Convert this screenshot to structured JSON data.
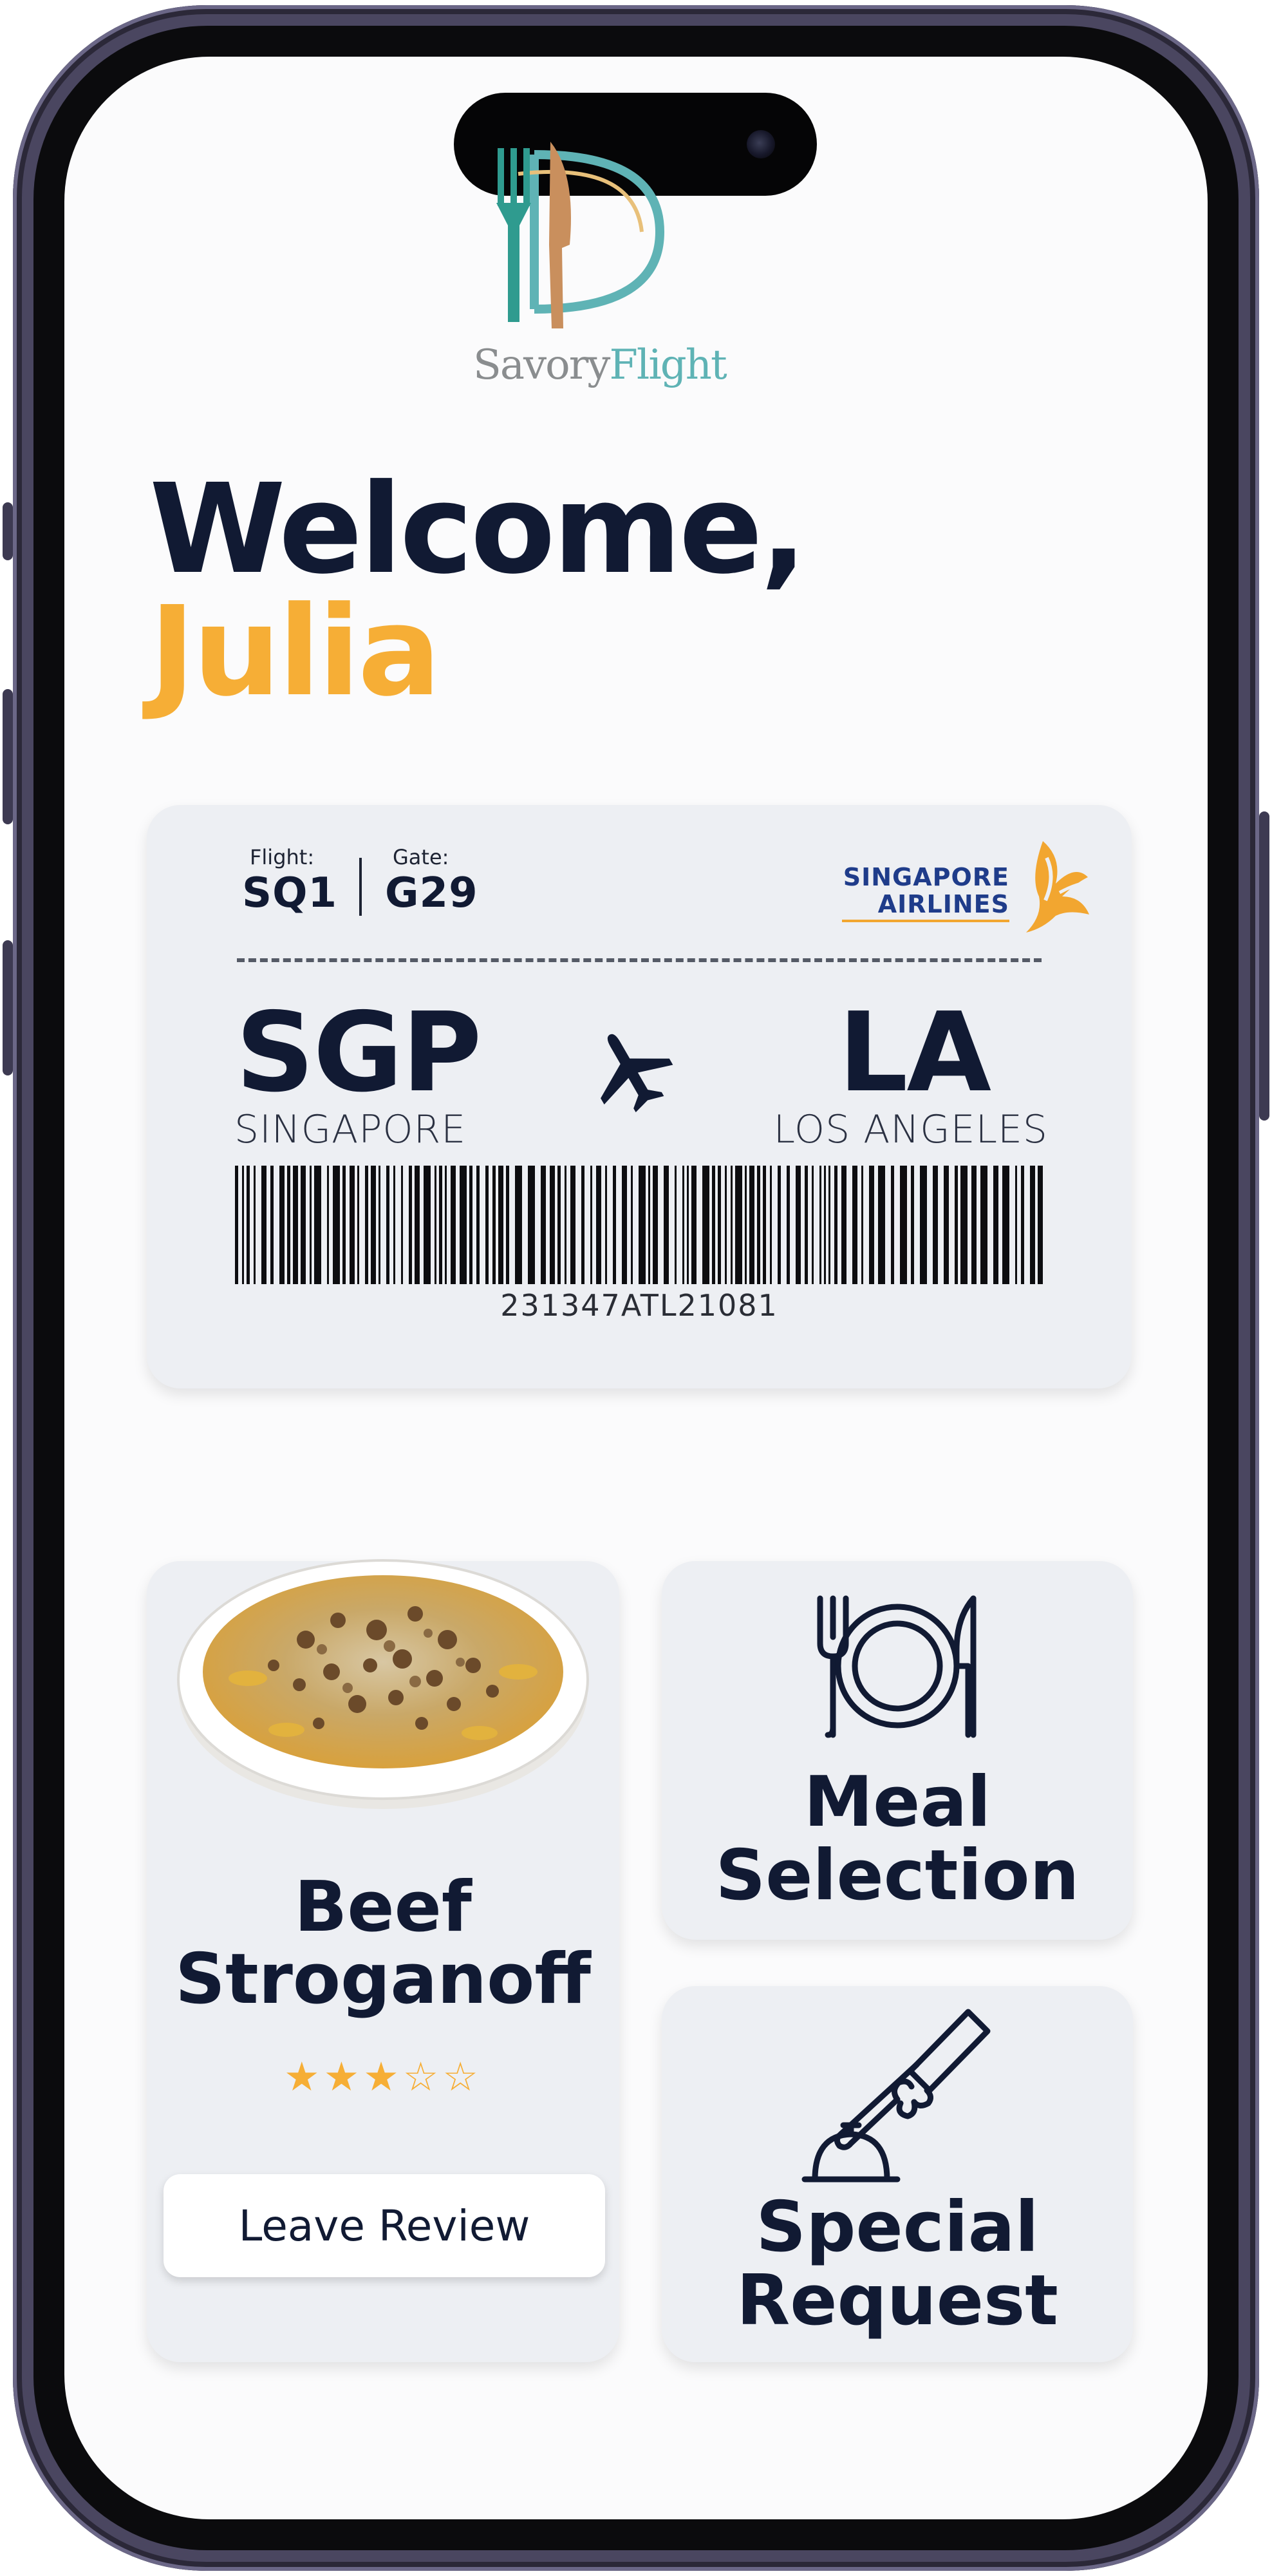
{
  "app": {
    "logo_part1": "Savory",
    "logo_part2": "Flight"
  },
  "welcome": {
    "greeting": "Welcome,",
    "name": "Julia"
  },
  "boarding_pass": {
    "flight_label": "Flight:",
    "flight_value": "SQ1",
    "gate_label": "Gate:",
    "gate_value": "G29",
    "airline_line1": "SINGAPORE",
    "airline_line2": "AIRLINES",
    "origin_code": "SGP",
    "origin_city": "SINGAPORE",
    "destination_code": "LA",
    "destination_city": "LOS ANGELES",
    "barcode_number": "231347ATL21081"
  },
  "meal_card": {
    "dish_name": "Beef Stroganoff",
    "rating": 3,
    "rating_max": 5,
    "rating_stars": "★★★☆☆",
    "review_button": "Leave Review"
  },
  "actions": {
    "meal_selection": "Meal Selection",
    "special_request": "Special Request"
  },
  "colors": {
    "navy": "#111a33",
    "accent": "#f6ae36",
    "card": "#edeff3"
  },
  "icons": [
    "plane-icon",
    "plate-cutlery-icon",
    "service-bell-icon",
    "airline-logo-icon",
    "app-logo-icon"
  ]
}
